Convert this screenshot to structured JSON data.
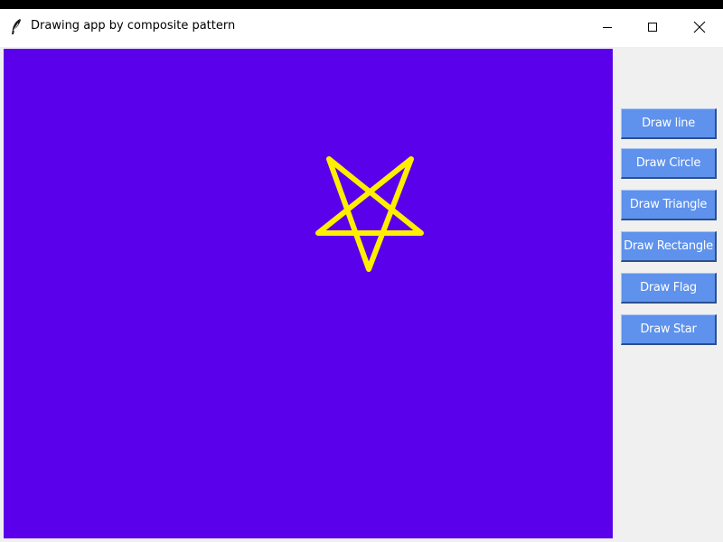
{
  "window": {
    "title": "Drawing app by composite pattern",
    "controls": {
      "minimize": "minimize-icon",
      "maximize": "maximize-icon",
      "close": "close-icon"
    }
  },
  "canvas": {
    "background_color": "#5b00ea",
    "star_color": "#ffee00",
    "shape": "star"
  },
  "buttons": {
    "draw_line": "Draw line",
    "draw_circle": "Draw Circle",
    "draw_triangle": "Draw Triangle",
    "draw_rectangle": "Draw Rectangle",
    "draw_flag": "Draw Flag",
    "draw_star": "Draw Star",
    "color": "#5e92ec"
  }
}
